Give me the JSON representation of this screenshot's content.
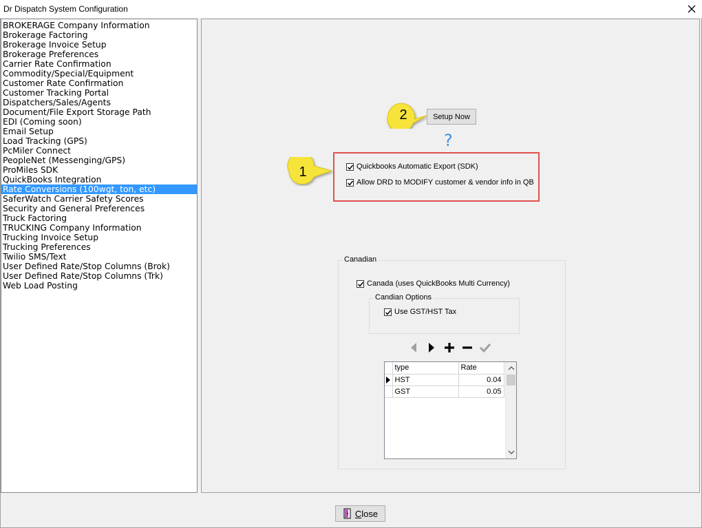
{
  "window": {
    "title": "Dr Dispatch  System Configuration",
    "close_glyph": "✕"
  },
  "sidebar": {
    "selected_index": 17,
    "items": [
      "BROKERAGE Company Information",
      "Brokerage Factoring",
      "Brokerage Invoice Setup",
      "Brokerage Preferences",
      "Carrier Rate Confirmation",
      "Commodity/Special/Equipment",
      "Customer Rate Confirmation",
      "Customer Tracking Portal",
      "Dispatchers/Sales/Agents",
      "Document/File Export Storage Path",
      "EDI (Coming soon)",
      "Email Setup",
      "Load Tracking (GPS)",
      "PcMiler Connect",
      "PeopleNet (Messenging/GPS)",
      "ProMiles SDK",
      "QuickBooks Integration",
      "Rate Conversions (100wgt, ton, etc)",
      "SaferWatch Carrier Safety Scores",
      "Security and General Preferences",
      "Truck Factoring",
      "TRUCKING Company Information",
      "Trucking Invoice Setup",
      "Trucking Preferences",
      "Twilio SMS/Text",
      "User Defined Rate/Stop Columns (Brok)",
      "User Defined Rate/Stop Columns (Trk)",
      "Web Load Posting"
    ]
  },
  "callouts": {
    "one": "1",
    "two": "2"
  },
  "setup": {
    "button_label": "Setup Now",
    "help_glyph": "?"
  },
  "quickbooks": {
    "auto_export_label": "Quickbooks Automatic Export (SDK)",
    "auto_export_checked": true,
    "modify_label": "Allow DRD to MODIFY customer & vendor info in QB",
    "modify_checked": true
  },
  "canadian": {
    "group_label": "Canadian",
    "canada_label": "Canada (uses QuickBooks Multi Currency)",
    "canada_checked": true,
    "options_group_label": "Candian Options",
    "gst_label": "Use GST/HST Tax",
    "gst_checked": true,
    "nav_icons": [
      "prev-icon",
      "next-icon",
      "add-icon",
      "remove-icon",
      "confirm-icon"
    ],
    "grid": {
      "headers": [
        "type",
        "Rate"
      ],
      "rows": [
        {
          "type": "HST",
          "rate": "0.04",
          "current": true
        },
        {
          "type": "GST",
          "rate": "0.05",
          "current": false
        }
      ]
    }
  },
  "footer": {
    "close_label": "Close",
    "close_mnemonic": "C",
    "close_rest": "lose"
  },
  "colors": {
    "selection": "#3399ff",
    "redbox": "#e0514d",
    "callout": "#f7e43a",
    "help": "#3a92e6"
  }
}
